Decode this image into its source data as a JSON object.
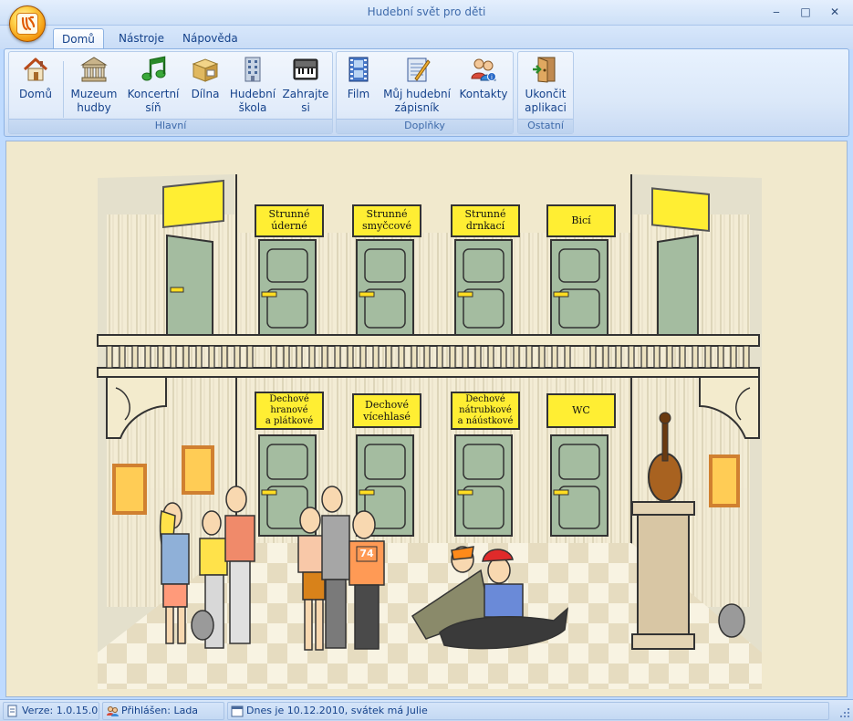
{
  "window": {
    "title": "Hudební svět pro děti",
    "minimize": "‒",
    "maximize": "□",
    "close": "✕"
  },
  "tabs": [
    "Domů",
    "Nástroje",
    "Nápověda"
  ],
  "ribbon": {
    "groups": [
      {
        "label": "Hlavní",
        "buttons": [
          {
            "line1": "Domů",
            "line2": "",
            "icon": "house-icon"
          },
          {
            "line1": "Muzeum",
            "line2": "hudby",
            "icon": "museum-icon"
          },
          {
            "line1": "Koncertní",
            "line2": "síň",
            "icon": "music-note-icon"
          },
          {
            "line1": "Dílna",
            "line2": "",
            "icon": "box-icon"
          },
          {
            "line1": "Hudební",
            "line2": "škola",
            "icon": "building-icon"
          },
          {
            "line1": "Zahrajte",
            "line2": "si",
            "icon": "keyboard-icon"
          }
        ]
      },
      {
        "label": "Doplňky",
        "buttons": [
          {
            "line1": "Film",
            "line2": "",
            "icon": "film-icon"
          },
          {
            "line1": "Můj hudební",
            "line2": "zápisník",
            "icon": "notebook-icon"
          },
          {
            "line1": "Kontakty",
            "line2": "",
            "icon": "contacts-icon"
          }
        ]
      },
      {
        "label": "Ostatní",
        "buttons": [
          {
            "line1": "Ukončit",
            "line2": "aplikaci",
            "icon": "exit-door-icon"
          }
        ]
      }
    ]
  },
  "scene": {
    "upper_signs": [
      {
        "line1": "Strunné",
        "line2": "úderné"
      },
      {
        "line1": "Strunné",
        "line2": "smyčcové"
      },
      {
        "line1": "Strunné",
        "line2": "drnkací"
      },
      {
        "line1": "Bicí",
        "line2": ""
      }
    ],
    "lower_signs": [
      {
        "line1": "Dechové",
        "line2": "hranové",
        "line3": "a plátkové"
      },
      {
        "line1": "Dechové",
        "line2": "vícehlasé",
        "line3": ""
      },
      {
        "line1": "Dechové",
        "line2": "nátrubkové",
        "line3": "a náústkové"
      },
      {
        "line1": "WC",
        "line2": "",
        "line3": ""
      }
    ],
    "shirt_number": "74"
  },
  "status": {
    "version": "Verze: 1.0.15.0",
    "user": "Přihlášen: Lada",
    "date": "Dnes je 10.12.2010, svátek má Julie"
  }
}
